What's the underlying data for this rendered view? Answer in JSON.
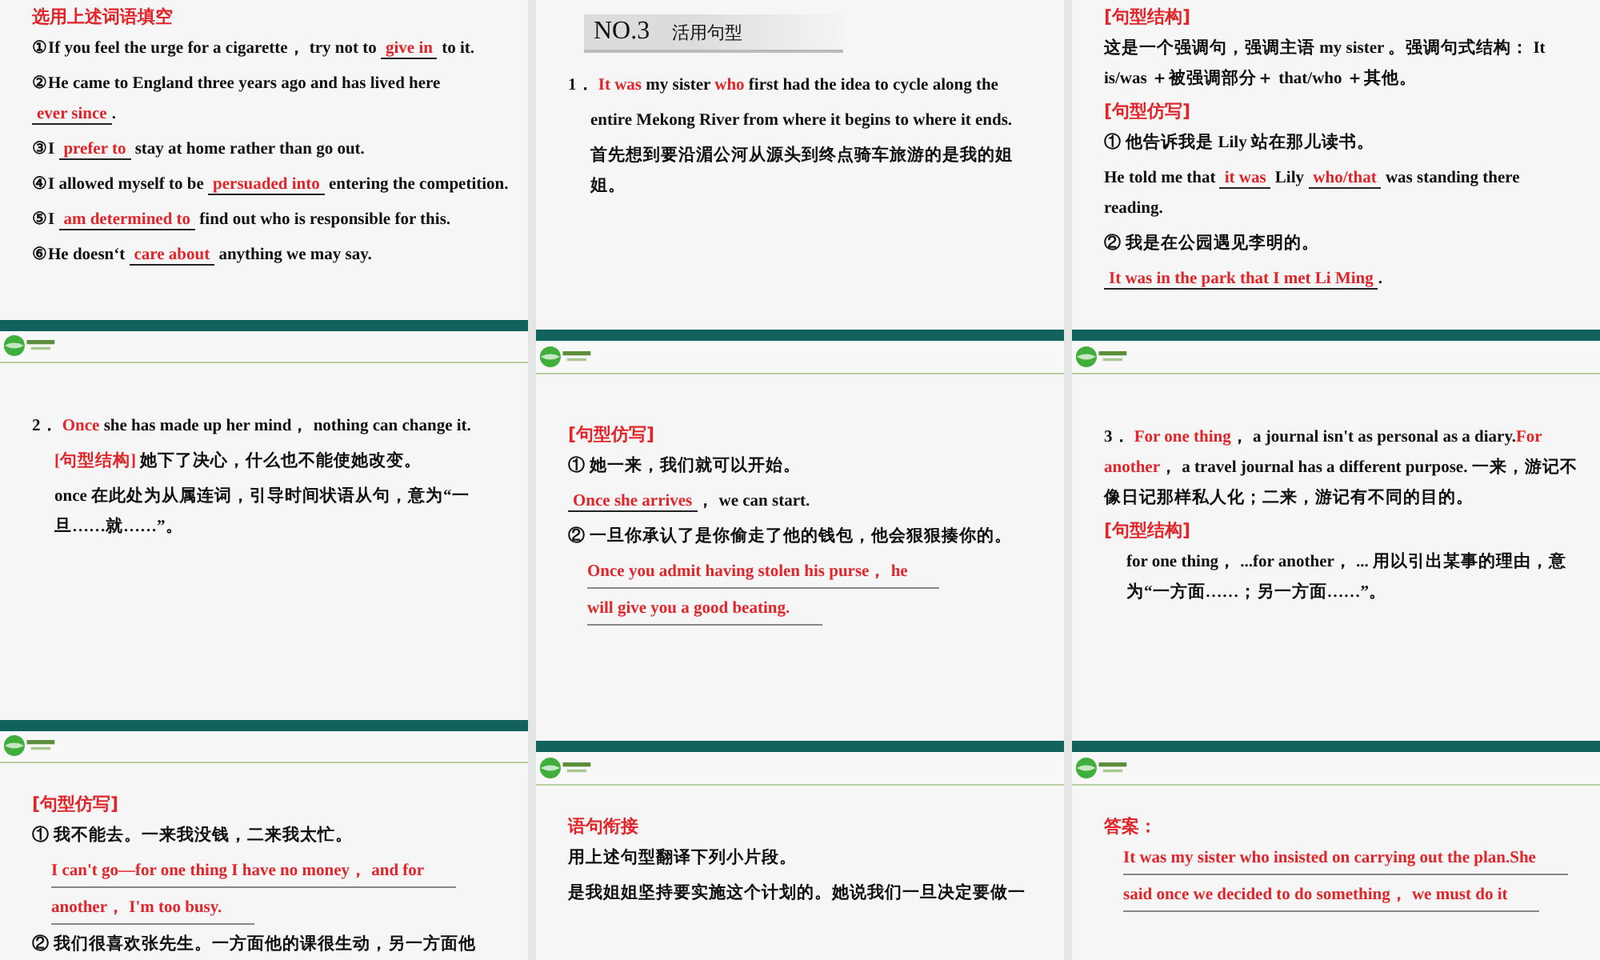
{
  "columns": [
    {
      "panels": [
        {
          "lines": [
            {
              "kind": "heading",
              "text": "选用上述词语填空"
            },
            {
              "kind": "para",
              "indent": false,
              "parts": [
                {
                  "kind": "text",
                  "text": "①If you feel the urge for a cigarette， try not to "
                },
                {
                  "kind": "blank",
                  "text": "give in"
                },
                {
                  "kind": "text",
                  "text": " to it."
                }
              ]
            },
            {
              "kind": "para",
              "indent": false,
              "parts": [
                {
                  "kind": "text",
                  "text": "②He came to England three years ago and has lived here "
                },
                {
                  "kind": "blank",
                  "text": "ever since"
                },
                {
                  "kind": "text",
                  "text": "."
                }
              ]
            },
            {
              "kind": "para",
              "indent": false,
              "parts": [
                {
                  "kind": "text",
                  "text": "③I "
                },
                {
                  "kind": "blank",
                  "text": "prefer to"
                },
                {
                  "kind": "text",
                  "text": " stay at home rather than go out."
                }
              ]
            },
            {
              "kind": "para",
              "indent": false,
              "parts": [
                {
                  "kind": "text",
                  "text": "④I allowed myself to be "
                },
                {
                  "kind": "blank",
                  "text": "persuaded into"
                },
                {
                  "kind": "text",
                  "text": " entering the competition."
                }
              ]
            },
            {
              "kind": "para",
              "indent": false,
              "parts": [
                {
                  "kind": "text",
                  "text": "⑤I "
                },
                {
                  "kind": "blank",
                  "text": "am determined to"
                },
                {
                  "kind": "text",
                  "text": " find out who is responsible for this."
                }
              ]
            },
            {
              "kind": "para",
              "indent": false,
              "parts": [
                {
                  "kind": "text",
                  "text": "⑥He doesn‘t "
                },
                {
                  "kind": "blank",
                  "text": "care about"
                },
                {
                  "kind": "text",
                  "text": " anything we may say."
                }
              ]
            }
          ]
        },
        {
          "lines": [
            {
              "kind": "para",
              "indent": false,
              "parts": [
                {
                  "kind": "text",
                  "text": "2． "
                },
                {
                  "kind": "red",
                  "text": "Once"
                },
                {
                  "kind": "text",
                  "text": " she has made up her mind， nothing can change it."
                }
              ]
            },
            {
              "kind": "para",
              "indent": true,
              "parts": [
                {
                  "kind": "red",
                  "text": "[句型结构] "
                },
                {
                  "kind": "text",
                  "text": "她下了决心，什么也不能使她改变。"
                }
              ]
            },
            {
              "kind": "para",
              "indent": true,
              "parts": [
                {
                  "kind": "text",
                  "text": "once 在此处为从属连词，引导时间状语从句，意为“一旦……就……”。"
                }
              ]
            }
          ]
        },
        {
          "lines": [
            {
              "kind": "heading",
              "text": "[句型仿写]"
            },
            {
              "kind": "para",
              "indent": false,
              "parts": [
                {
                  "kind": "text",
                  "text": "① 我不能去。一来我没钱，二来我太忙。"
                }
              ]
            },
            {
              "kind": "answer",
              "text": "I can't go—for one thing I have no money， and for"
            },
            {
              "kind": "answer",
              "text": "another， I'm too busy."
            },
            {
              "kind": "para",
              "indent": false,
              "parts": [
                {
                  "kind": "text",
                  "text": "② 我们很喜欢张先生。一方面他的课很生动，另一方面他"
                }
              ]
            }
          ]
        }
      ]
    },
    {
      "panels": [
        {
          "section": {
            "number": "NO.3",
            "title": "活用句型"
          },
          "lines": [
            {
              "kind": "para",
              "indent": false,
              "parts": [
                {
                  "kind": "text",
                  "text": "1． "
                },
                {
                  "kind": "red",
                  "text": "It was"
                },
                {
                  "kind": "text",
                  "text": " my sister "
                },
                {
                  "kind": "red",
                  "text": "who"
                },
                {
                  "kind": "text",
                  "text": " first had the idea to cycle along the"
                }
              ]
            },
            {
              "kind": "para",
              "indent": true,
              "parts": [
                {
                  "kind": "text",
                  "text": "entire Mekong River from where it begins to where it ends."
                }
              ]
            },
            {
              "kind": "para",
              "indent": true,
              "parts": [
                {
                  "kind": "text",
                  "text": "首先想到要沿湄公河从源头到终点骑车旅游的是我的姐姐。"
                }
              ]
            }
          ]
        },
        {
          "lines": [
            {
              "kind": "heading",
              "text": "[句型仿写]"
            },
            {
              "kind": "para",
              "indent": false,
              "parts": [
                {
                  "kind": "text",
                  "text": "① 她一来，我们就可以开始。"
                }
              ]
            },
            {
              "kind": "para",
              "indent": false,
              "parts": [
                {
                  "kind": "blank",
                  "text": "Once she arrives"
                },
                {
                  "kind": "text",
                  "text": "， we can start."
                }
              ]
            },
            {
              "kind": "para",
              "indent": false,
              "parts": [
                {
                  "kind": "text",
                  "text": "② 一旦你承认了是你偷走了他的钱包，他会狠狠揍你的。"
                }
              ]
            },
            {
              "kind": "answer",
              "text": "Once you admit having stolen his purse， he"
            },
            {
              "kind": "answer",
              "text": "will give you a good beating."
            }
          ]
        },
        {
          "lines": [
            {
              "kind": "heading",
              "text": "语句衔接"
            },
            {
              "kind": "para",
              "indent": false,
              "parts": [
                {
                  "kind": "text",
                  "text": "用上述句型翻译下列小片段。"
                }
              ]
            },
            {
              "kind": "para",
              "indent": false,
              "parts": [
                {
                  "kind": "text",
                  "text": "是我姐姐坚持要实施这个计划的。她说我们一旦决定要做一"
                }
              ]
            }
          ]
        }
      ]
    },
    {
      "panels": [
        {
          "lines": [
            {
              "kind": "heading",
              "text": "[句型结构]"
            },
            {
              "kind": "para",
              "indent": false,
              "parts": [
                {
                  "kind": "text",
                  "text": "这是一个强调句，强调主语 my sister 。强调句式结构： It is/was ＋被强调部分＋ that/who ＋其他。"
                }
              ]
            },
            {
              "kind": "heading",
              "text": "[句型仿写]"
            },
            {
              "kind": "para",
              "indent": false,
              "parts": [
                {
                  "kind": "text",
                  "text": "① 他告诉我是 Lily 站在那儿读书。"
                }
              ]
            },
            {
              "kind": "para",
              "indent": false,
              "parts": [
                {
                  "kind": "text",
                  "text": "He told me that "
                },
                {
                  "kind": "blank",
                  "text": "it was"
                },
                {
                  "kind": "text",
                  "text": " Lily "
                },
                {
                  "kind": "blank",
                  "text": "who/that"
                },
                {
                  "kind": "text",
                  "text": " was standing there reading."
                }
              ]
            },
            {
              "kind": "para",
              "indent": false,
              "parts": [
                {
                  "kind": "text",
                  "text": "② 我是在公园遇见李明的。"
                }
              ]
            },
            {
              "kind": "para",
              "indent": false,
              "parts": [
                {
                  "kind": "blank",
                  "text": "It was in the park that I met Li Ming"
                },
                {
                  "kind": "text",
                  "text": "."
                }
              ]
            }
          ]
        },
        {
          "lines": [
            {
              "kind": "para",
              "indent": false,
              "parts": [
                {
                  "kind": "text",
                  "text": "3． "
                },
                {
                  "kind": "red",
                  "text": "For one thing"
                },
                {
                  "kind": "text",
                  "text": "， a journal isn't as personal as a diary."
                },
                {
                  "kind": "red",
                  "text": "For another"
                },
                {
                  "kind": "text",
                  "text": "， a travel journal has a different purpose. 一来，游记不像日记那样私人化；二来，游记有不同的目的。"
                }
              ]
            },
            {
              "kind": "heading",
              "text": "[句型结构]"
            },
            {
              "kind": "para",
              "indent": true,
              "parts": [
                {
                  "kind": "text",
                  "text": "for one thing， ...for another， ... 用以引出某事的理由，意为“一方面……；另一方面……”。"
                }
              ]
            }
          ]
        },
        {
          "lines": [
            {
              "kind": "heading",
              "text": "答案："
            },
            {
              "kind": "answer",
              "text": "It was my sister who insisted on carrying out the plan.She"
            },
            {
              "kind": "answer",
              "text": "said once we decided to  do something， we  must do it"
            }
          ]
        }
      ]
    }
  ]
}
